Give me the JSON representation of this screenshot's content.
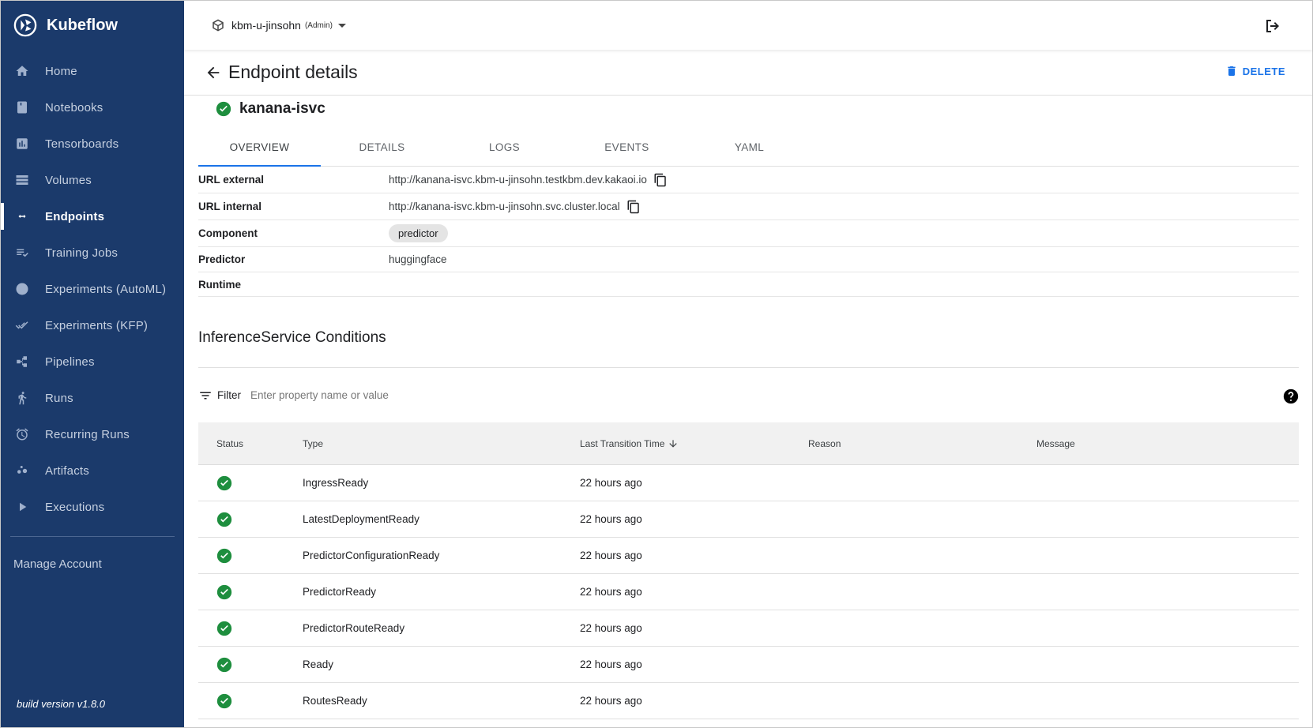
{
  "brand": {
    "name": "Kubeflow"
  },
  "sidebar": {
    "items": [
      {
        "label": "Home",
        "icon": "home-icon"
      },
      {
        "label": "Notebooks",
        "icon": "notebook-icon"
      },
      {
        "label": "Tensorboards",
        "icon": "chart-icon"
      },
      {
        "label": "Volumes",
        "icon": "storage-icon"
      },
      {
        "label": "Endpoints",
        "icon": "endpoint-icon",
        "active": true
      },
      {
        "label": "Training Jobs",
        "icon": "playlist-icon"
      },
      {
        "label": "Experiments (AutoML)",
        "icon": "globe-icon"
      },
      {
        "label": "Experiments (KFP)",
        "icon": "checks-icon"
      },
      {
        "label": "Pipelines",
        "icon": "pipeline-icon"
      },
      {
        "label": "Runs",
        "icon": "run-icon"
      },
      {
        "label": "Recurring Runs",
        "icon": "alarm-icon"
      },
      {
        "label": "Artifacts",
        "icon": "bubbles-icon"
      },
      {
        "label": "Executions",
        "icon": "play-icon"
      }
    ],
    "manage_account": "Manage Account",
    "build_version": "build version v1.8.0"
  },
  "topbar": {
    "namespace": "kbm-u-jinsohn",
    "role": "(Admin)"
  },
  "header": {
    "title": "Endpoint details",
    "delete_label": "DELETE"
  },
  "service": {
    "name": "kanana-isvc",
    "status_color": "#1e8e3e"
  },
  "tabs": [
    "OVERVIEW",
    "DETAILS",
    "LOGS",
    "EVENTS",
    "YAML"
  ],
  "overview": {
    "url_external_label": "URL external",
    "url_external": "http://kanana-isvc.kbm-u-jinsohn.testkbm.dev.kakaoi.io",
    "url_internal_label": "URL internal",
    "url_internal": "http://kanana-isvc.kbm-u-jinsohn.svc.cluster.local",
    "component_label": "Component",
    "component": "predictor",
    "predictor_label": "Predictor",
    "predictor": "huggingface",
    "runtime_label": "Runtime",
    "runtime": ""
  },
  "conditions": {
    "title": "InferenceService Conditions",
    "filter_label": "Filter",
    "filter_placeholder": "Enter property name or value",
    "columns": {
      "status": "Status",
      "type": "Type",
      "time": "Last Transition Time",
      "reason": "Reason",
      "message": "Message"
    },
    "rows": [
      {
        "type": "IngressReady",
        "time": "22 hours ago"
      },
      {
        "type": "LatestDeploymentReady",
        "time": "22 hours ago"
      },
      {
        "type": "PredictorConfigurationReady",
        "time": "22 hours ago"
      },
      {
        "type": "PredictorReady",
        "time": "22 hours ago"
      },
      {
        "type": "PredictorRouteReady",
        "time": "22 hours ago"
      },
      {
        "type": "Ready",
        "time": "22 hours ago"
      },
      {
        "type": "RoutesReady",
        "time": "22 hours ago"
      }
    ]
  },
  "colors": {
    "sidebar": "#1b3a6b",
    "accent": "#1a73e8",
    "success": "#1e8e3e"
  }
}
